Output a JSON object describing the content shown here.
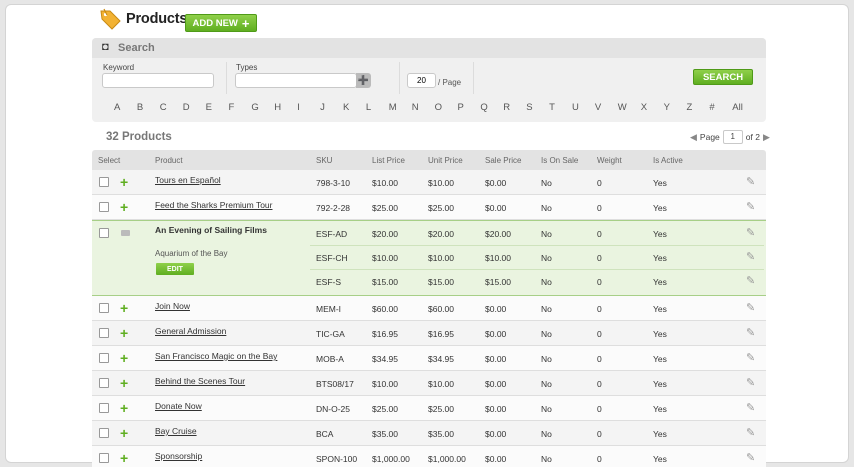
{
  "header": {
    "title": "Products",
    "add_new_label": "ADD NEW",
    "add_new_icon": "plus-icon",
    "title_icon": "price-tag-icon"
  },
  "search": {
    "title": "Search",
    "keyword_label": "Keyword",
    "keyword_value": "",
    "types_label": "Types",
    "types_value": "",
    "per_page_value": "20",
    "per_page_label": "/ Page",
    "button_label": "SEARCH"
  },
  "letters": [
    "A",
    "B",
    "C",
    "D",
    "E",
    "F",
    "G",
    "H",
    "I",
    "J",
    "K",
    "L",
    "M",
    "N",
    "O",
    "P",
    "Q",
    "R",
    "S",
    "T",
    "U",
    "V",
    "W",
    "X",
    "Y",
    "Z",
    "#",
    "All"
  ],
  "summary": {
    "count_label": "32 Products",
    "page_label": "Page",
    "page_value": "1",
    "of_label": "of 2"
  },
  "table": {
    "headers": [
      "Select",
      "Product",
      "SKU",
      "List Price",
      "Unit Price",
      "Sale Price",
      "Is On Sale",
      "Weight",
      "Is Active"
    ],
    "rows": [
      {
        "product": "Tours en Español",
        "sku": "798-3-10",
        "list": "$10.00",
        "unit": "$10.00",
        "sale": "$0.00",
        "onsale": "No",
        "weight": "0",
        "active": "Yes"
      },
      {
        "product": "Feed the Sharks Premium Tour",
        "sku": "792-2-28",
        "list": "$25.00",
        "unit": "$25.00",
        "sale": "$0.00",
        "onsale": "No",
        "weight": "0",
        "active": "Yes"
      },
      {
        "product": "Join Now",
        "sku": "MEM-I",
        "list": "$60.00",
        "unit": "$60.00",
        "sale": "$0.00",
        "onsale": "No",
        "weight": "0",
        "active": "Yes"
      },
      {
        "product": "General Admission",
        "sku": "TIC-GA",
        "list": "$16.95",
        "unit": "$16.95",
        "sale": "$0.00",
        "onsale": "No",
        "weight": "0",
        "active": "Yes"
      },
      {
        "product": "San Francisco Magic on the Bay",
        "sku": "MOB-A",
        "list": "$34.95",
        "unit": "$34.95",
        "sale": "$0.00",
        "onsale": "No",
        "weight": "0",
        "active": "Yes"
      },
      {
        "product": "Behind the Scenes Tour",
        "sku": "BTS08/17",
        "list": "$10.00",
        "unit": "$10.00",
        "sale": "$0.00",
        "onsale": "No",
        "weight": "0",
        "active": "Yes"
      },
      {
        "product": "Donate Now",
        "sku": "DN-O-25",
        "list": "$25.00",
        "unit": "$25.00",
        "sale": "$0.00",
        "onsale": "No",
        "weight": "0",
        "active": "Yes"
      },
      {
        "product": "Bay Cruise",
        "sku": "BCA",
        "list": "$35.00",
        "unit": "$35.00",
        "sale": "$0.00",
        "onsale": "No",
        "weight": "0",
        "active": "Yes"
      },
      {
        "product": "Sponsorship",
        "sku": "SPON-100",
        "list": "$1,000.00",
        "unit": "$1,000.00",
        "sale": "$0.00",
        "onsale": "No",
        "weight": "0",
        "active": "Yes"
      }
    ],
    "expanded": {
      "product": "An Evening of Sailing Films",
      "subtitle": "Aquarium of the Bay",
      "edit_label": "EDIT",
      "variants": [
        {
          "sku": "ESF-AD",
          "list": "$20.00",
          "unit": "$20.00",
          "sale": "$20.00",
          "onsale": "No",
          "weight": "0",
          "active": "Yes"
        },
        {
          "sku": "ESF-CH",
          "list": "$10.00",
          "unit": "$10.00",
          "sale": "$10.00",
          "onsale": "No",
          "weight": "0",
          "active": "Yes"
        },
        {
          "sku": "ESF-S",
          "list": "$15.00",
          "unit": "$15.00",
          "sale": "$15.00",
          "onsale": "No",
          "weight": "0",
          "active": "Yes"
        }
      ]
    }
  },
  "colors": {
    "accent_green": "#5fae20",
    "expanded_bg": "#eaf4e0"
  }
}
